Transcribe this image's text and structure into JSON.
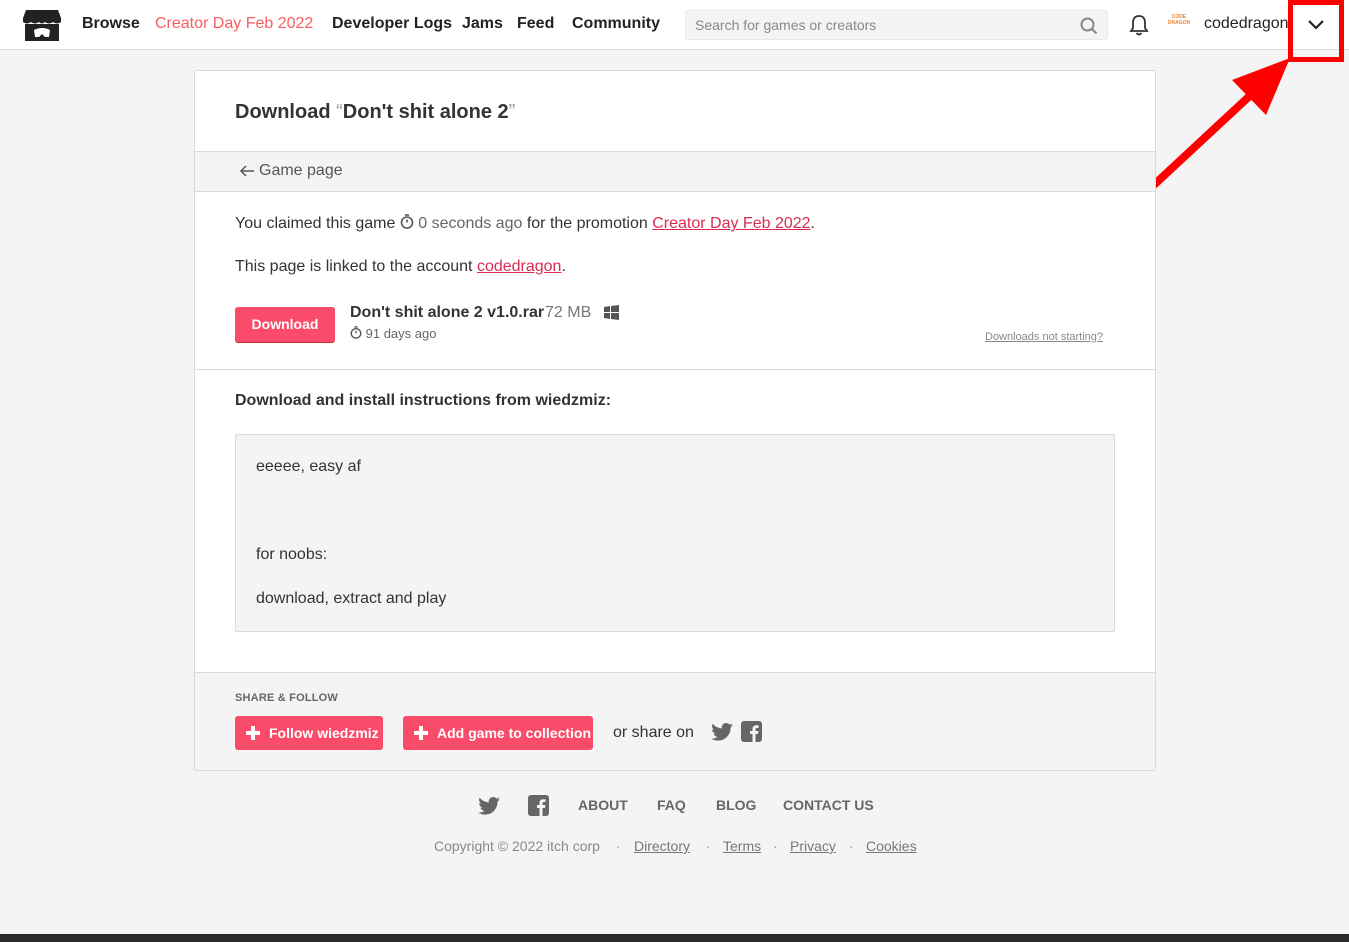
{
  "header": {
    "nav": [
      "Browse",
      "Creator Day Feb 2022",
      "Developer Logs",
      "Jams",
      "Feed",
      "Community"
    ],
    "search_placeholder": "Search for games or creators",
    "avatar_text": "CODE DRAGON",
    "username": "codedragon"
  },
  "page": {
    "title_prefix": "Download ",
    "title_open_quote": "“",
    "title_game": "Don't shit alone 2",
    "title_close_quote": "”",
    "back_label": "Game page",
    "claim_text": "You claimed this game",
    "claim_time": "0 seconds ago",
    "claim_promo_text": "for the promotion",
    "promo_link": "Creator Day Feb 2022",
    "linked_text": "This page is linked to the account",
    "account_link": "codedragon",
    "download_button": "Download",
    "file_name": "Don't shit alone 2 v1.0.rar",
    "file_size": "72 MB",
    "file_date": "91 days ago",
    "not_starting_link": "Downloads not starting?",
    "instructions_title": "Download and install instructions from wiedzmiz:",
    "instructions": [
      "eeeee, easy af",
      "for noobs:",
      "download, extract and play"
    ],
    "share_label": "SHARE & FOLLOW",
    "follow_button": "Follow wiedzmiz",
    "collection_button": "Add game to collection",
    "share_on": "or share on"
  },
  "footer": {
    "links": [
      "ABOUT",
      "FAQ",
      "BLOG",
      "CONTACT US"
    ],
    "copyright": "Copyright © 2022 itch corp",
    "sub_links": [
      "Directory",
      "Terms",
      "Privacy",
      "Cookies"
    ]
  },
  "colors": {
    "accent": "#fa5c5c",
    "button": "#fa4c6a",
    "link": "#da2c53",
    "annotation": "#ff0000"
  }
}
